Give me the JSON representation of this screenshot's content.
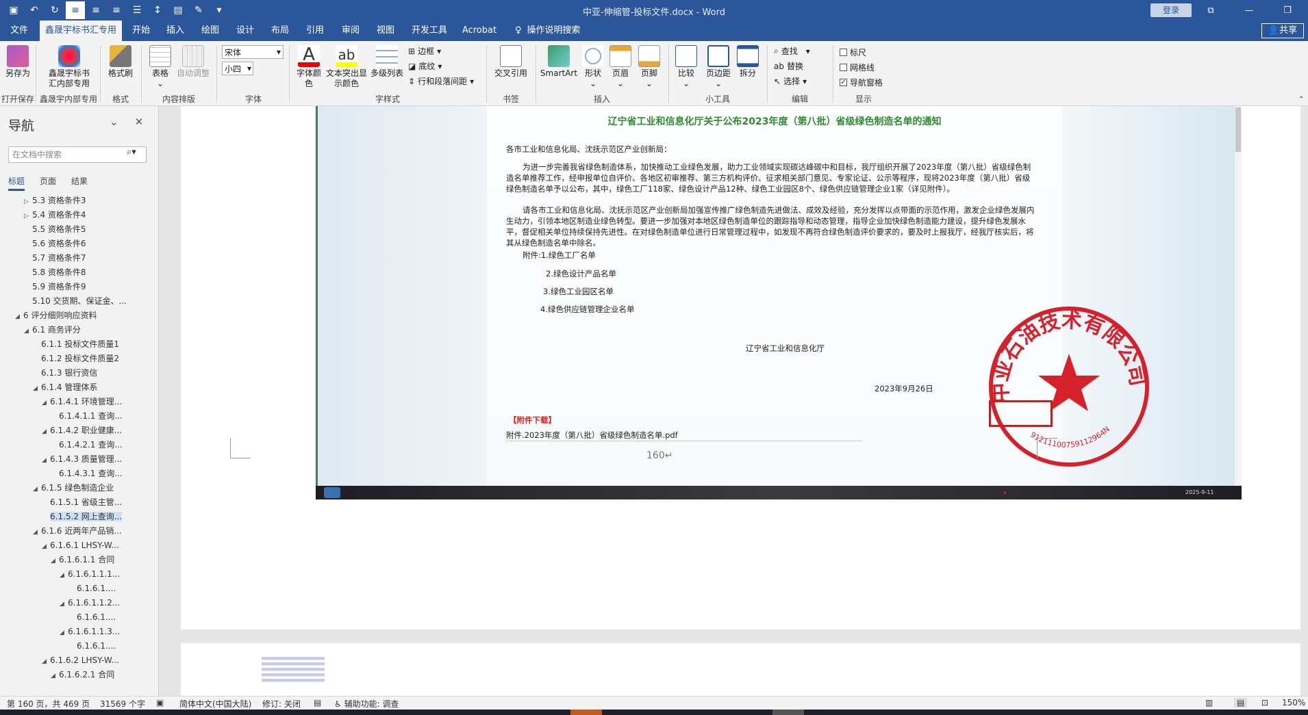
{
  "window": {
    "title": "中亚-伸缩管-投标文件.docx  -  Word",
    "login": "登录"
  },
  "tabs": [
    "文件",
    "鑫晟宇标书汇专用",
    "开始",
    "插入",
    "绘图",
    "设计",
    "布局",
    "引用",
    "审阅",
    "视图",
    "开发工具",
    "Acrobat"
  ],
  "active_tab": "鑫晟宇标书汇专用",
  "tellme": "操作说明搜索",
  "share": "共享",
  "ribbon": {
    "save_as": "另存为",
    "xsy_btn_l1": "鑫晟宇标书",
    "xsy_btn_l2": "汇内部专用",
    "format_painter": "格式刷",
    "table": "表格",
    "autofit": "自动调整",
    "font_name": "宋体",
    "font_size": "小四",
    "font_color_l1": "字体颜",
    "font_color_l2": "色",
    "highlight_l1": "文本突出显",
    "highlight_l2": "示颜色",
    "multilevel": "多级列表",
    "border": "边框",
    "shading": "底纹",
    "spacing": "行和段落间距",
    "crossref": "交叉引用",
    "smartart": "SmartArt",
    "shape": "形状",
    "header": "页眉",
    "footer": "页脚",
    "compare": "比较",
    "margins": "页边距",
    "split": "拆分",
    "find": "查找",
    "replace": "替换",
    "select": "选择",
    "ruler": "标尺",
    "gridlines": "网格线",
    "nav_pane": "导航窗格",
    "groups": [
      "打开保存",
      "鑫晟宇内部专用",
      "格式",
      "内容排版",
      "字体",
      "字样式",
      "书签",
      "插入",
      "小工具",
      "编辑",
      "显示"
    ]
  },
  "nav": {
    "title": "导航",
    "search_placeholder": "在文档中搜索",
    "tabs": [
      "标题",
      "页面",
      "结果"
    ],
    "items": [
      {
        "label": "5.3 资格条件3",
        "level": 3,
        "arrow": "▷"
      },
      {
        "label": "5.4 资格条件4",
        "level": 3,
        "arrow": "▷"
      },
      {
        "label": "5.5 资格条件5",
        "level": 3,
        "arrow": ""
      },
      {
        "label": "5.6 资格条件6",
        "level": 3,
        "arrow": ""
      },
      {
        "label": "5.7 资格条件7",
        "level": 3,
        "arrow": ""
      },
      {
        "label": "5.8 资格条件8",
        "level": 3,
        "arrow": ""
      },
      {
        "label": "5.9 资格条件9",
        "level": 3,
        "arrow": ""
      },
      {
        "label": "5.10 交货期、保证金、...",
        "level": 3,
        "arrow": ""
      },
      {
        "label": "6 评分细则响应资料",
        "level": 2,
        "arrow": "◢"
      },
      {
        "label": "6.1 商务评分",
        "level": 3,
        "arrow": "◢"
      },
      {
        "label": "6.1.1 投标文件质量1",
        "level": 4,
        "arrow": ""
      },
      {
        "label": "6.1.2 投标文件质量2",
        "level": 4,
        "arrow": ""
      },
      {
        "label": "6.1.3 银行资信",
        "level": 4,
        "arrow": ""
      },
      {
        "label": "6.1.4 管理体系",
        "level": 4,
        "arrow": "◢"
      },
      {
        "label": "6.1.4.1 环境管理...",
        "level": 5,
        "arrow": "◢"
      },
      {
        "label": "6.1.4.1.1 查询...",
        "level": 6,
        "arrow": ""
      },
      {
        "label": "6.1.4.2 职业健康...",
        "level": 5,
        "arrow": "◢"
      },
      {
        "label": "6.1.4.2.1 查询...",
        "level": 6,
        "arrow": ""
      },
      {
        "label": "6.1.4.3 质量管理...",
        "level": 5,
        "arrow": "◢"
      },
      {
        "label": "6.1.4.3.1 查询...",
        "level": 6,
        "arrow": ""
      },
      {
        "label": "6.1.5 绿色制造企业",
        "level": 4,
        "arrow": "◢"
      },
      {
        "label": "6.1.5.1 省级主管...",
        "level": 5,
        "arrow": ""
      },
      {
        "label": "6.1.5.2 网上查询...",
        "level": 5,
        "arrow": "",
        "selected": true
      },
      {
        "label": "6.1.6 近两年产品销...",
        "level": 4,
        "arrow": "◢"
      },
      {
        "label": "6.1.6.1 LHSY-W...",
        "level": 5,
        "arrow": "◢"
      },
      {
        "label": "6.1.6.1.1 合同",
        "level": 6,
        "arrow": "◢"
      },
      {
        "label": "6.1.6.1.1.1...",
        "level": 7,
        "arrow": "◢"
      },
      {
        "label": "6.1.6.1....",
        "level": 8,
        "arrow": ""
      },
      {
        "label": "6.1.6.1.1.2...",
        "level": 7,
        "arrow": "◢"
      },
      {
        "label": "6.1.6.1....",
        "level": 8,
        "arrow": ""
      },
      {
        "label": "6.1.6.1.1.3...",
        "level": 7,
        "arrow": "◢"
      },
      {
        "label": "6.1.6.1....",
        "level": 8,
        "arrow": ""
      },
      {
        "label": "6.1.6.2 LHSY-W...",
        "level": 5,
        "arrow": "◢"
      },
      {
        "label": "6.1.6.2.1 合同",
        "level": 6,
        "arrow": "◢"
      }
    ]
  },
  "notice": {
    "title": "辽宁省工业和信息化厅关于公布2023年度（第八批）省级绿色制造名单的通知",
    "salutation": "各市工业和信息化局、沈抚示范区产业创新局：",
    "p1": "为进一步完善我省绿色制造体系，加快推动工业绿色发展，助力工业领域实现碳达峰碳中和目标，我厅组织开展了2023年度（第八批）省级绿色制造名单推荐工作，经申报单位自评价、各地区初审推荐、第三方机构评价、征求相关部门意见、专家论证、公示等程序，现将2023年度（第八批）省级绿色制造名单予以公布，其中，绿色工厂118家、绿色设计产品12种、绿色工业园区8个、绿色供应链管理企业1家（详见附件）。",
    "p2": "请各市工业和信息化局、沈抚示范区产业创新局加强宣传推广绿色制造先进做法、成效及经验，充分发挥以点带面的示范作用，激发企业绿色发展内生动力，引领本地区制造业绿色转型。要进一步加强对本地区绿色制造单位的跟踪指导和动态管理，指导企业加快绿色制造能力建设，提升绿色发展水平，督促相关单位持续保持先进性。在对绿色制造单位进行日常管理过程中，如发现不再符合绿色制造评价要求的，要及时上报我厅，经我厅核实后，将其从绿色制造名单中除名。",
    "att1": "附件:1.绿色工厂名单",
    "att2": "2.绿色设计产品名单",
    "att3": "3.绿色工业园区名单",
    "att4": "4.绿色供应链管理企业名单",
    "issuer": "辽宁省工业和信息化厅",
    "date": "2023年9月26日",
    "download_label": "【附件下载】",
    "attachment_file": "附件.2023年度（第八批）省级绿色制造名单.pdf",
    "taskbar_date": "2025-9-11"
  },
  "stamp": {
    "company": "中亚石油技术有限公司",
    "code": "91211100759112964N"
  },
  "page_number": "160↵",
  "status": {
    "page": "第 160 页，共 469 页",
    "words": "31569 个字",
    "language": "简体中文(中国大陆)",
    "track": "修订: 关闭",
    "accessibility": "辅助功能: 调查",
    "zoom": "150%"
  },
  "colors": {
    "accent": "#2b579a",
    "stamp_red": "#d6202a",
    "title_green": "#2e8b2e"
  }
}
